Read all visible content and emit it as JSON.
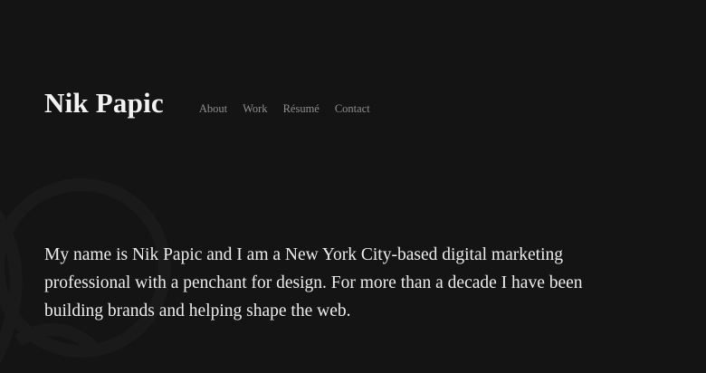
{
  "site": {
    "title": "Nik Papic"
  },
  "nav": {
    "items": [
      {
        "label": "About"
      },
      {
        "label": "Work"
      },
      {
        "label": "Résumé"
      },
      {
        "label": "Contact"
      }
    ]
  },
  "intro": {
    "text": "My name is Nik Papic and I am a New York City-based digital marketing professional with a penchant for design. For more than a decade I have been building brands and helping shape the web."
  },
  "colors": {
    "background": "#151415",
    "title": "#f2f2f2",
    "nav_link": "#8e8e8e",
    "body_text": "#ececec"
  }
}
